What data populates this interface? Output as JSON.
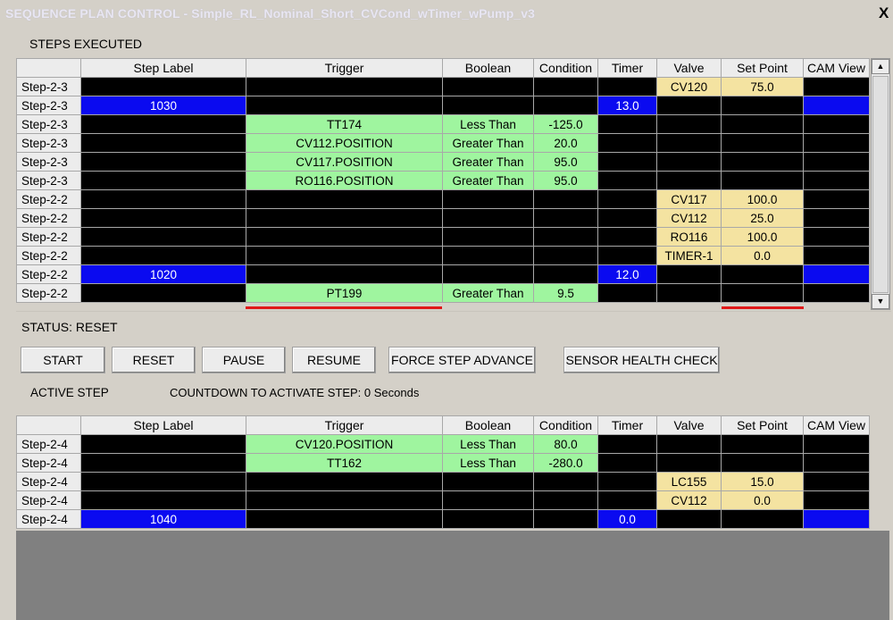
{
  "window": {
    "title": "SEQUENCE PLAN CONTROL - Simple_RL_Nominal_Short_CVCond_wTimer_wPump_v3",
    "close_glyph": "X"
  },
  "labels": {
    "steps_executed": "STEPS EXECUTED",
    "status": "STATUS: RESET",
    "active_step": "ACTIVE STEP",
    "countdown": "COUNTDOWN TO ACTIVATE STEP:  0 Seconds"
  },
  "columns": [
    "Step Label",
    "Trigger",
    "Boolean",
    "Condition",
    "Timer",
    "Valve",
    "Set Point",
    "CAM View"
  ],
  "executed": {
    "rows": [
      {
        "step": "Step-2-3",
        "label": "",
        "trigger": "",
        "boolean": "",
        "condition": "",
        "timer": "",
        "valve": "CV120",
        "setpoint": "75.0",
        "cam": ""
      },
      {
        "step": "Step-2-3",
        "label": "1030",
        "trigger": "",
        "boolean": "",
        "condition": "",
        "timer": "13.0",
        "valve": "",
        "setpoint": "",
        "cam": ""
      },
      {
        "step": "Step-2-3",
        "label": "",
        "trigger": "TT174",
        "boolean": "Less Than",
        "condition": "-125.0",
        "timer": "",
        "valve": "",
        "setpoint": "",
        "cam": ""
      },
      {
        "step": "Step-2-3",
        "label": "",
        "trigger": "CV112.POSITION",
        "boolean": "Greater Than",
        "condition": "20.0",
        "timer": "",
        "valve": "",
        "setpoint": "",
        "cam": ""
      },
      {
        "step": "Step-2-3",
        "label": "",
        "trigger": "CV117.POSITION",
        "boolean": "Greater Than",
        "condition": "95.0",
        "timer": "",
        "valve": "",
        "setpoint": "",
        "cam": ""
      },
      {
        "step": "Step-2-3",
        "label": "",
        "trigger": "RO116.POSITION",
        "boolean": "Greater Than",
        "condition": "95.0",
        "timer": "",
        "valve": "",
        "setpoint": "",
        "cam": ""
      },
      {
        "step": "Step-2-2",
        "label": "",
        "trigger": "",
        "boolean": "",
        "condition": "",
        "timer": "",
        "valve": "CV117",
        "setpoint": "100.0",
        "cam": ""
      },
      {
        "step": "Step-2-2",
        "label": "",
        "trigger": "",
        "boolean": "",
        "condition": "",
        "timer": "",
        "valve": "CV112",
        "setpoint": "25.0",
        "cam": ""
      },
      {
        "step": "Step-2-2",
        "label": "",
        "trigger": "",
        "boolean": "",
        "condition": "",
        "timer": "",
        "valve": "RO116",
        "setpoint": "100.0",
        "cam": ""
      },
      {
        "step": "Step-2-2",
        "label": "",
        "trigger": "",
        "boolean": "",
        "condition": "",
        "timer": "",
        "valve": "TIMER-1",
        "setpoint": "0.0",
        "cam": ""
      },
      {
        "step": "Step-2-2",
        "label": "1020",
        "trigger": "",
        "boolean": "",
        "condition": "",
        "timer": "12.0",
        "valve": "",
        "setpoint": "",
        "cam": ""
      },
      {
        "step": "Step-2-2",
        "label": "",
        "trigger": "PT199",
        "boolean": "Greater Than",
        "condition": "9.5",
        "timer": "",
        "valve": "",
        "setpoint": "",
        "cam": ""
      }
    ]
  },
  "buttons": {
    "start": "START",
    "reset": "RESET",
    "pause": "PAUSE",
    "resume": "RESUME",
    "force_step_advance": "FORCE STEP ADVANCE",
    "sensor_health_check": "SENSOR HEALTH CHECK"
  },
  "active": {
    "rows": [
      {
        "step": "Step-2-4",
        "label": "",
        "trigger": "CV120.POSITION",
        "boolean": "Less Than",
        "condition": "80.0",
        "timer": "",
        "valve": "",
        "setpoint": "",
        "cam": ""
      },
      {
        "step": "Step-2-4",
        "label": "",
        "trigger": "TT162",
        "boolean": "Less Than",
        "condition": "-280.0",
        "timer": "",
        "valve": "",
        "setpoint": "",
        "cam": ""
      },
      {
        "step": "Step-2-4",
        "label": "",
        "trigger": "",
        "boolean": "",
        "condition": "",
        "timer": "",
        "valve": "LC155",
        "setpoint": "15.0",
        "cam": ""
      },
      {
        "step": "Step-2-4",
        "label": "",
        "trigger": "",
        "boolean": "",
        "condition": "",
        "timer": "",
        "valve": "CV112",
        "setpoint": "0.0",
        "cam": ""
      },
      {
        "step": "Step-2-4",
        "label": "1040",
        "trigger": "",
        "boolean": "",
        "condition": "",
        "timer": "0.0",
        "valve": "",
        "setpoint": "",
        "cam": ""
      }
    ]
  },
  "scrollbar": {
    "up_icon": "▲",
    "down_icon": "▼"
  },
  "colors": {
    "step_label_marker": "#0a0af0",
    "trigger_highlight": "#9ff59f",
    "valve_highlight": "#f4e3a1",
    "empty_cell": "#000000",
    "partial_row_marker": "#e01818"
  }
}
